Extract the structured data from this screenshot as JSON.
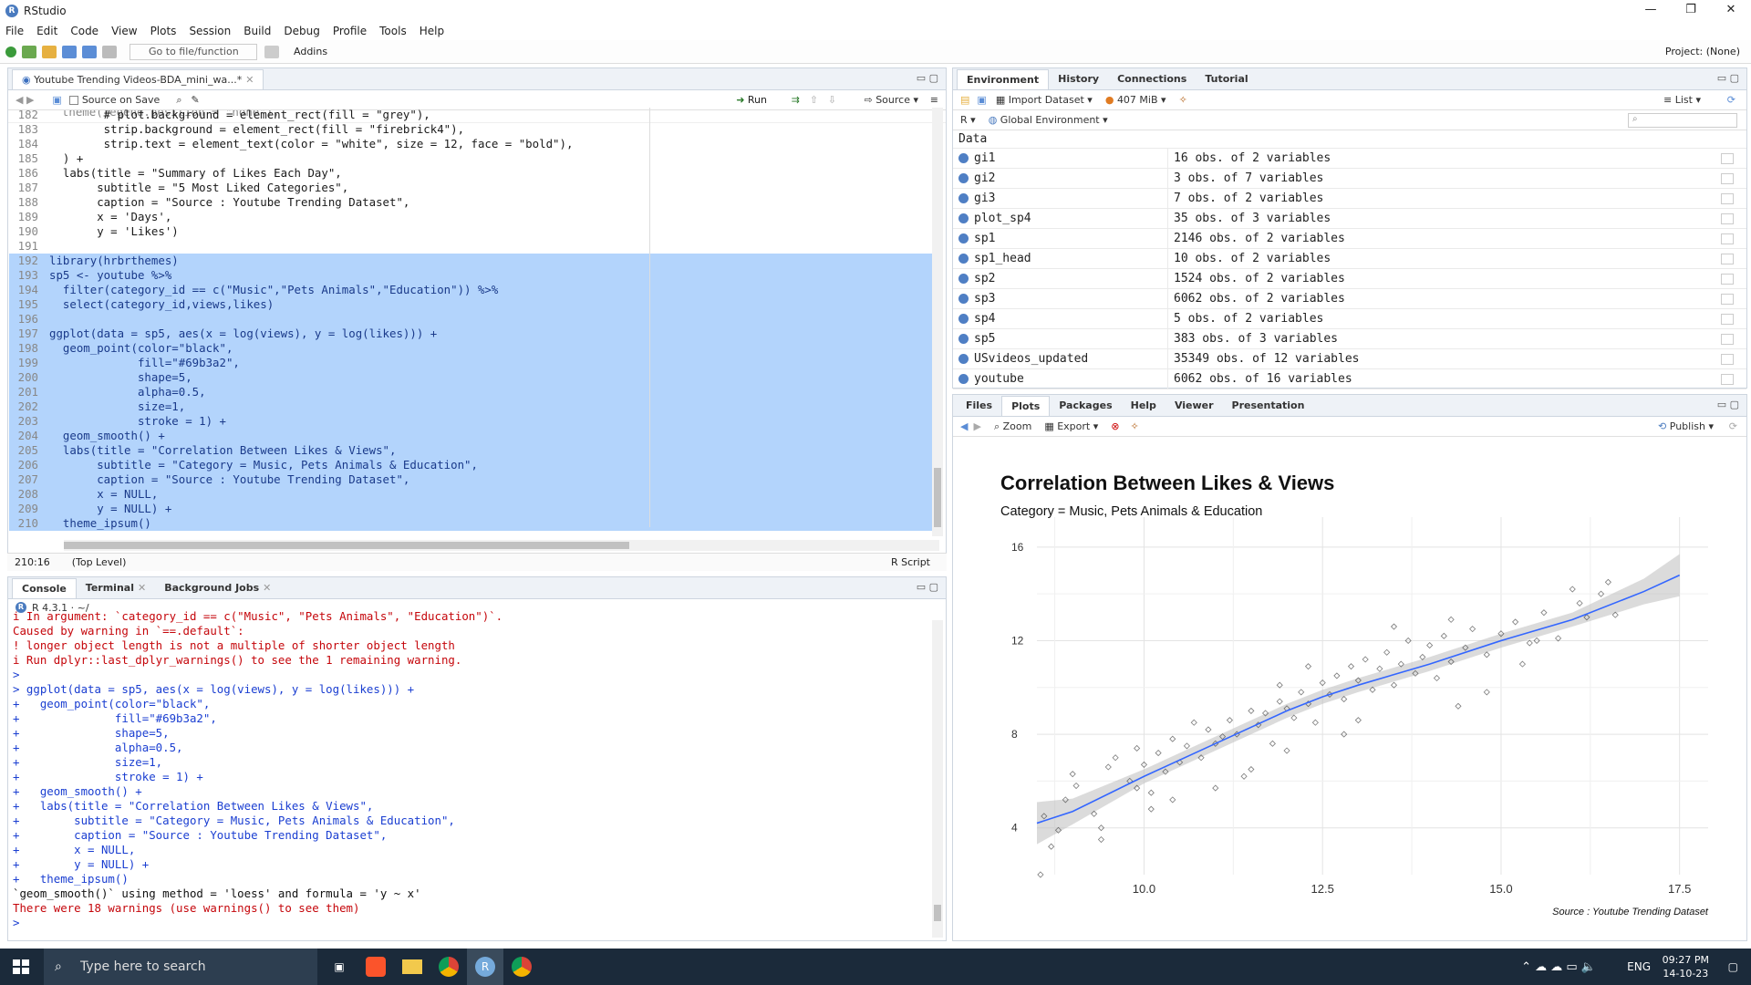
{
  "window": {
    "title": "RStudio",
    "controls": [
      "—",
      "❐",
      "✕"
    ]
  },
  "menu": [
    "File",
    "Edit",
    "Code",
    "View",
    "Plots",
    "Session",
    "Build",
    "Debug",
    "Profile",
    "Tools",
    "Help"
  ],
  "toolbar": {
    "goto_placeholder": "Go to file/function",
    "addins": "Addins",
    "project": "Project: (None)"
  },
  "editor": {
    "tab_title": "Youtube Trending Videos-BDA_mini_wa...*",
    "source_on_save": "Source on Save",
    "run_label": "Run",
    "source_label": "Source",
    "status_pos": "210:16",
    "status_scope": "(Top Level)",
    "status_type": "R Script",
    "lines": [
      {
        "n": "182",
        "t": "        # plot.background = element_rect(fill = \"grey\"),",
        "sel": false
      },
      {
        "n": "183",
        "t": "        strip.background = element_rect(fill = \"firebrick4\"),",
        "sel": false
      },
      {
        "n": "184",
        "t": "        strip.text = element_text(color = \"white\", size = 12, face = \"bold\"),",
        "sel": false
      },
      {
        "n": "185",
        "t": "  ) +",
        "sel": false
      },
      {
        "n": "186",
        "t": "  labs(title = \"Summary of Likes Each Day\",",
        "sel": false
      },
      {
        "n": "187",
        "t": "       subtitle = \"5 Most Liked Categories\",",
        "sel": false
      },
      {
        "n": "188",
        "t": "       caption = \"Source : Youtube Trending Dataset\",",
        "sel": false
      },
      {
        "n": "189",
        "t": "       x = 'Days',",
        "sel": false
      },
      {
        "n": "190",
        "t": "       y = 'Likes')",
        "sel": false
      },
      {
        "n": "191",
        "t": "",
        "sel": false
      },
      {
        "n": "192",
        "t": "library(hrbrthemes)",
        "sel": true
      },
      {
        "n": "193",
        "t": "sp5 <- youtube %>%",
        "sel": true
      },
      {
        "n": "194",
        "t": "  filter(category_id == c(\"Music\",\"Pets Animals\",\"Education\")) %>%",
        "sel": true
      },
      {
        "n": "195",
        "t": "  select(category_id,views,likes)",
        "sel": true
      },
      {
        "n": "196",
        "t": "",
        "sel": true
      },
      {
        "n": "197",
        "t": "ggplot(data = sp5, aes(x = log(views), y = log(likes))) +",
        "sel": true
      },
      {
        "n": "198",
        "t": "  geom_point(color=\"black\",",
        "sel": true
      },
      {
        "n": "199",
        "t": "             fill=\"#69b3a2\",",
        "sel": true
      },
      {
        "n": "200",
        "t": "             shape=5,",
        "sel": true
      },
      {
        "n": "201",
        "t": "             alpha=0.5,",
        "sel": true
      },
      {
        "n": "202",
        "t": "             size=1,",
        "sel": true
      },
      {
        "n": "203",
        "t": "             stroke = 1) +",
        "sel": true
      },
      {
        "n": "204",
        "t": "  geom_smooth() +",
        "sel": true
      },
      {
        "n": "205",
        "t": "  labs(title = \"Correlation Between Likes & Views\",",
        "sel": true
      },
      {
        "n": "206",
        "t": "       subtitle = \"Category = Music, Pets Animals & Education\",",
        "sel": true
      },
      {
        "n": "207",
        "t": "       caption = \"Source : Youtube Trending Dataset\",",
        "sel": true
      },
      {
        "n": "208",
        "t": "       x = NULL,",
        "sel": true
      },
      {
        "n": "209",
        "t": "       y = NULL) +",
        "sel": true
      },
      {
        "n": "210",
        "t": "  theme_ipsum()",
        "sel": true
      }
    ]
  },
  "console": {
    "tabs": [
      "Console",
      "Terminal",
      "Background Jobs"
    ],
    "version": "R 4.3.1 · ~/",
    "lines": [
      {
        "t": "i In argument: `category_id == c(\"Music\", \"Pets Animals\", \"Education\")`.",
        "c": "red"
      },
      {
        "t": "Caused by warning in `==.default`:",
        "c": "red"
      },
      {
        "t": "! longer object length is not a multiple of shorter object length",
        "c": "red"
      },
      {
        "t": "i Run dplyr::last_dplyr_warnings() to see the 1 remaining warning.",
        "c": "red"
      },
      {
        "t": ">",
        "c": "blue"
      },
      {
        "t": "> ggplot(data = sp5, aes(x = log(views), y = log(likes))) +",
        "c": "blue"
      },
      {
        "t": "+   geom_point(color=\"black\",",
        "c": "blue"
      },
      {
        "t": "+              fill=\"#69b3a2\",",
        "c": "blue"
      },
      {
        "t": "+              shape=5,",
        "c": "blue"
      },
      {
        "t": "+              alpha=0.5,",
        "c": "blue"
      },
      {
        "t": "+              size=1,",
        "c": "blue"
      },
      {
        "t": "+              stroke = 1) +",
        "c": "blue"
      },
      {
        "t": "+   geom_smooth() +",
        "c": "blue"
      },
      {
        "t": "+   labs(title = \"Correlation Between Likes & Views\",",
        "c": "blue"
      },
      {
        "t": "+        subtitle = \"Category = Music, Pets Animals & Education\",",
        "c": "blue"
      },
      {
        "t": "+        caption = \"Source : Youtube Trending Dataset\",",
        "c": "blue"
      },
      {
        "t": "+        x = NULL,",
        "c": "blue"
      },
      {
        "t": "+        y = NULL) +",
        "c": "blue"
      },
      {
        "t": "+   theme_ipsum()",
        "c": "blue"
      },
      {
        "t": "`geom_smooth()` using method = 'loess' and formula = 'y ~ x'",
        "c": "black"
      },
      {
        "t": "There were 18 warnings (use warnings() to see them)",
        "c": "red"
      },
      {
        "t": "> ",
        "c": "blue"
      }
    ]
  },
  "environment": {
    "tabs": [
      "Environment",
      "History",
      "Connections",
      "Tutorial"
    ],
    "import_label": "Import Dataset",
    "memory": "407 MiB",
    "list_label": "List",
    "lang": "R",
    "scope": "Global Environment",
    "section": "Data",
    "rows": [
      {
        "name": "gi1",
        "value": "16 obs. of 2 variables"
      },
      {
        "name": "gi2",
        "value": "3 obs. of 7 variables"
      },
      {
        "name": "gi3",
        "value": "7 obs. of 2 variables"
      },
      {
        "name": "plot_sp4",
        "value": "35 obs. of 3 variables"
      },
      {
        "name": "sp1",
        "value": "2146 obs. of 2 variables"
      },
      {
        "name": "sp1_head",
        "value": "10 obs. of 2 variables"
      },
      {
        "name": "sp2",
        "value": "1524 obs. of 2 variables"
      },
      {
        "name": "sp3",
        "value": "6062 obs. of 2 variables"
      },
      {
        "name": "sp4",
        "value": "5 obs. of 2 variables"
      },
      {
        "name": "sp5",
        "value": "383 obs. of 3 variables"
      },
      {
        "name": "USvideos_updated",
        "value": "35349 obs. of 12 variables"
      },
      {
        "name": "youtube",
        "value": "6062 obs. of 16 variables"
      }
    ]
  },
  "plots": {
    "tabs": [
      "Files",
      "Plots",
      "Packages",
      "Help",
      "Viewer",
      "Presentation"
    ],
    "zoom_label": "Zoom",
    "export_label": "Export",
    "publish_label": "Publish"
  },
  "chart_data": {
    "type": "scatter",
    "title": "Correlation Between Likes & Views",
    "subtitle": "Category = Music, Pets Animals & Education",
    "caption": "Source : Youtube Trending Dataset",
    "xlabel": "",
    "ylabel": "",
    "xlim": [
      8.5,
      17.9
    ],
    "ylim": [
      2.0,
      16.5
    ],
    "x_ticks": [
      "10.0",
      "12.5",
      "15.0",
      "17.5"
    ],
    "y_ticks": [
      "4",
      "8",
      "12",
      "16"
    ],
    "grid": true,
    "point_shape": "diamond",
    "smooth_line": {
      "x": [
        8.5,
        9.0,
        10.0,
        11.0,
        12.0,
        12.5,
        13.0,
        14.0,
        15.0,
        16.0,
        17.0,
        17.5
      ],
      "y": [
        4.2,
        4.7,
        6.2,
        7.6,
        9.0,
        9.6,
        10.1,
        11.0,
        12.0,
        12.9,
        14.1,
        14.8
      ]
    },
    "points": [
      [
        8.55,
        2.0
      ],
      [
        8.7,
        3.2
      ],
      [
        8.6,
        4.5
      ],
      [
        8.9,
        5.2
      ],
      [
        9.0,
        6.3
      ],
      [
        9.05,
        5.8
      ],
      [
        9.4,
        4.0
      ],
      [
        9.4,
        3.5
      ],
      [
        9.6,
        7.0
      ],
      [
        9.5,
        6.6
      ],
      [
        9.8,
        6.0
      ],
      [
        9.9,
        5.7
      ],
      [
        10.0,
        6.7
      ],
      [
        10.1,
        5.5
      ],
      [
        10.2,
        7.2
      ],
      [
        10.3,
        6.4
      ],
      [
        10.4,
        7.8
      ],
      [
        10.5,
        6.8
      ],
      [
        10.6,
        7.5
      ],
      [
        10.7,
        8.5
      ],
      [
        10.8,
        7.0
      ],
      [
        10.9,
        8.2
      ],
      [
        11.0,
        7.6
      ],
      [
        11.1,
        7.9
      ],
      [
        11.2,
        8.6
      ],
      [
        11.3,
        8.0
      ],
      [
        11.4,
        6.2
      ],
      [
        11.5,
        9.0
      ],
      [
        11.6,
        8.4
      ],
      [
        11.7,
        8.9
      ],
      [
        11.8,
        7.6
      ],
      [
        11.9,
        9.4
      ],
      [
        12.0,
        9.1
      ],
      [
        12.1,
        8.7
      ],
      [
        12.2,
        9.8
      ],
      [
        12.3,
        9.3
      ],
      [
        12.4,
        8.5
      ],
      [
        12.5,
        10.2
      ],
      [
        12.6,
        9.7
      ],
      [
        12.7,
        10.5
      ],
      [
        12.8,
        9.5
      ],
      [
        12.9,
        10.9
      ],
      [
        13.0,
        10.3
      ],
      [
        13.1,
        11.2
      ],
      [
        13.2,
        9.9
      ],
      [
        13.3,
        10.8
      ],
      [
        13.4,
        11.5
      ],
      [
        13.5,
        10.1
      ],
      [
        13.6,
        11.0
      ],
      [
        13.7,
        12.0
      ],
      [
        13.8,
        10.6
      ],
      [
        13.9,
        11.3
      ],
      [
        14.0,
        11.8
      ],
      [
        14.1,
        10.4
      ],
      [
        14.2,
        12.2
      ],
      [
        14.3,
        11.1
      ],
      [
        14.4,
        9.2
      ],
      [
        14.5,
        11.7
      ],
      [
        14.6,
        12.5
      ],
      [
        14.8,
        11.4
      ],
      [
        15.0,
        12.3
      ],
      [
        15.2,
        12.8
      ],
      [
        15.4,
        11.9
      ],
      [
        15.6,
        13.2
      ],
      [
        15.8,
        12.1
      ],
      [
        16.0,
        14.2
      ],
      [
        16.2,
        13.0
      ],
      [
        16.4,
        14.0
      ],
      [
        16.1,
        13.6
      ],
      [
        15.5,
        12.0
      ],
      [
        12.0,
        7.3
      ],
      [
        11.0,
        5.7
      ],
      [
        10.4,
        5.2
      ],
      [
        9.3,
        4.6
      ],
      [
        13.0,
        8.6
      ],
      [
        14.8,
        9.8
      ],
      [
        16.6,
        13.1
      ],
      [
        12.8,
        8.0
      ],
      [
        11.5,
        6.5
      ],
      [
        10.1,
        4.8
      ],
      [
        8.8,
        3.9
      ],
      [
        9.9,
        7.4
      ],
      [
        13.5,
        12.6
      ],
      [
        14.3,
        12.9
      ],
      [
        12.3,
        10.9
      ],
      [
        11.9,
        10.1
      ],
      [
        15.3,
        11.0
      ],
      [
        16.5,
        14.5
      ]
    ]
  },
  "taskbar": {
    "search": "Type here to search",
    "time": "09:27 PM",
    "date": "14-10-23",
    "lang": "ENG"
  }
}
